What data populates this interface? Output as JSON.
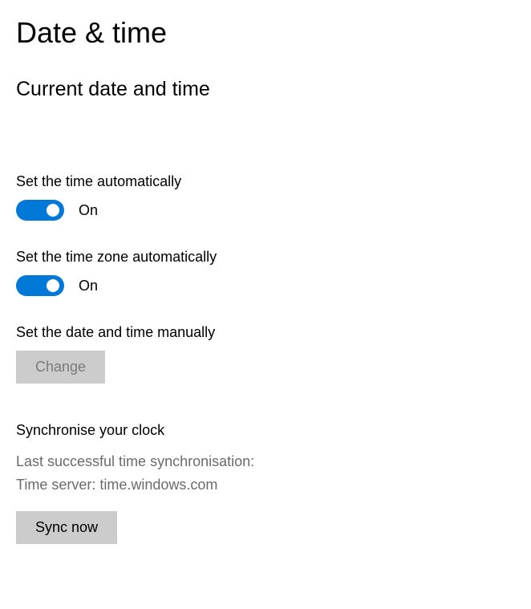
{
  "page": {
    "title": "Date & time",
    "section_heading": "Current date and time"
  },
  "settings": {
    "auto_time": {
      "label": "Set the time automatically",
      "state": "On",
      "on": true
    },
    "auto_timezone": {
      "label": "Set the time zone automatically",
      "state": "On",
      "on": true
    },
    "manual": {
      "label": "Set the date and time manually",
      "button": "Change",
      "enabled": false
    }
  },
  "sync": {
    "heading": "Synchronise your clock",
    "last_sync_label": "Last successful time synchronisation:",
    "server_label": "Time server: time.windows.com",
    "button": "Sync now"
  }
}
